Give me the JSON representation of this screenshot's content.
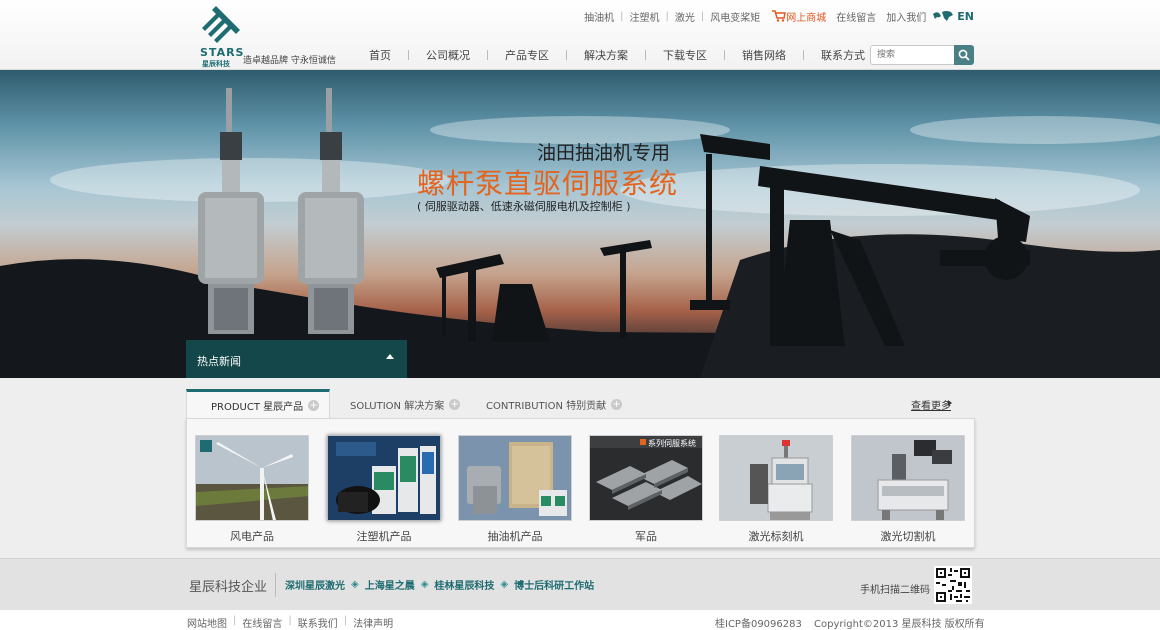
{
  "logo": {
    "en": "STARS",
    "cn": "星辰科技",
    "slogan": "造卓越品牌  守永恒诚信"
  },
  "toplinks": {
    "items": [
      "抽油机",
      "注塑机",
      "激光",
      "风电变桨矩"
    ],
    "shop": "网上商城",
    "message": "在线留言",
    "join": "加入我们",
    "lang": "EN"
  },
  "nav": [
    "首页",
    "公司概况",
    "产品专区",
    "解决方案",
    "下载专区",
    "销售网络",
    "联系方式"
  ],
  "search": {
    "placeholder": "搜索"
  },
  "banner": {
    "line1": "油田抽油机专用",
    "line2": "螺杆泵直驱伺服系统",
    "line3": "( 伺服驱动器、低速永磁伺服电机及控制柜 )",
    "news": "热点新闻"
  },
  "tabs": {
    "product": "PRODUCT 星辰产品",
    "solution": "SOLUTION 解决方案",
    "contribution": "CONTRIBUTION 特别贡献",
    "more": "查看更多"
  },
  "products": [
    {
      "label": "风电产品"
    },
    {
      "label": "注塑机产品"
    },
    {
      "label": "抽油机产品"
    },
    {
      "label": "军品",
      "tag": "系列伺服系统"
    },
    {
      "label": "激光标刻机"
    },
    {
      "label": "激光切割机"
    }
  ],
  "subfooter": {
    "title": "星辰科技企业",
    "links": [
      "深圳星辰激光",
      "上海星之晨",
      "桂林星辰科技",
      "博士后科研工作站"
    ],
    "qr_label": "手机扫描二维码"
  },
  "footer": {
    "links": [
      "网站地图",
      "在线留言",
      "联系我们",
      "法律声明"
    ],
    "icp": "桂ICP备09096283",
    "copyright": "Copyright©2013  星辰科技  版权所有"
  },
  "colors": {
    "brand": "#1e6c72",
    "accent": "#e2641f"
  }
}
